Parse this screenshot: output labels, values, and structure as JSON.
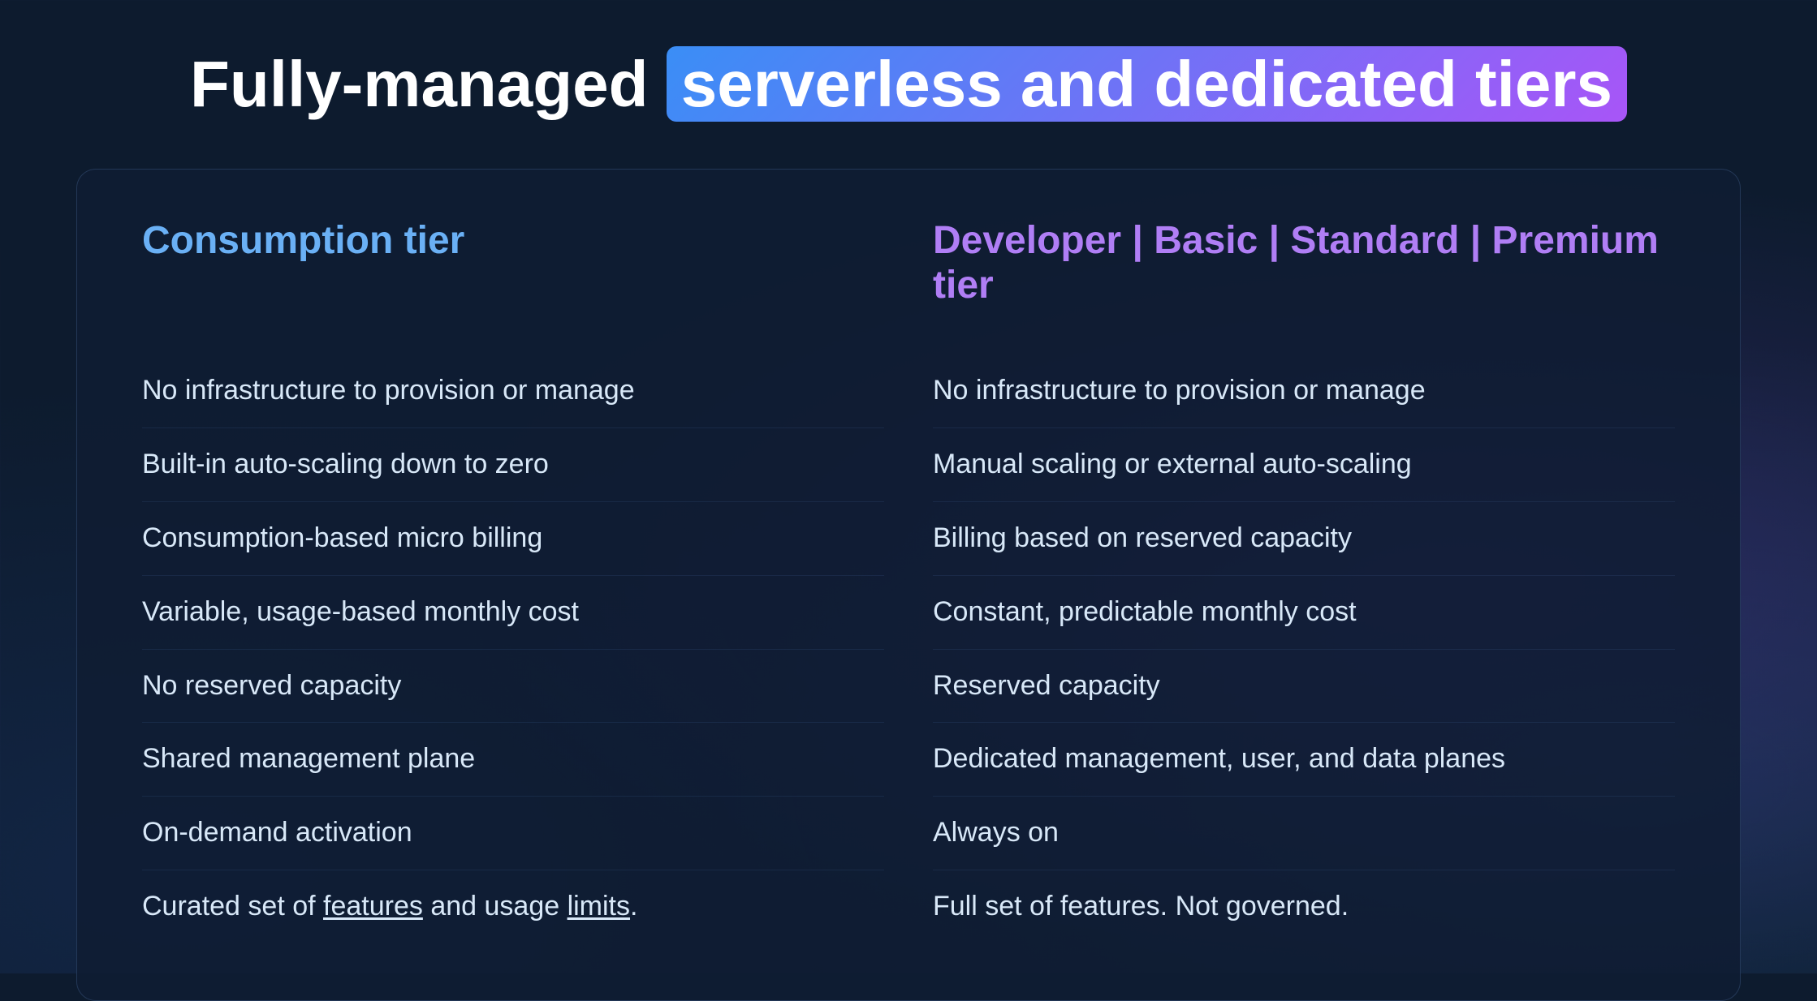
{
  "title": {
    "prefix": "Fully-managed ",
    "highlight": "serverless and dedicated tiers"
  },
  "columns": {
    "left": {
      "header": "Consumption tier",
      "features": [
        "No infrastructure to provision or manage",
        "Built-in auto-scaling down to zero",
        "Consumption-based micro billing",
        "Variable, usage-based monthly cost",
        "No reserved capacity",
        "Shared management plane",
        "On-demand activation",
        "Curated set of features and usage limits."
      ],
      "feature_links": [
        null,
        null,
        null,
        null,
        null,
        null,
        null,
        "features_and_limits"
      ]
    },
    "right": {
      "header": "Developer | Basic | Standard | Premium tier",
      "features": [
        "No infrastructure to provision or manage",
        "Manual scaling or external auto-scaling",
        "Billing based on reserved capacity",
        "Constant, predictable monthly cost",
        "Reserved capacity",
        "Dedicated management, user, and data planes",
        "Always on",
        "Full set of features. Not governed."
      ]
    }
  }
}
